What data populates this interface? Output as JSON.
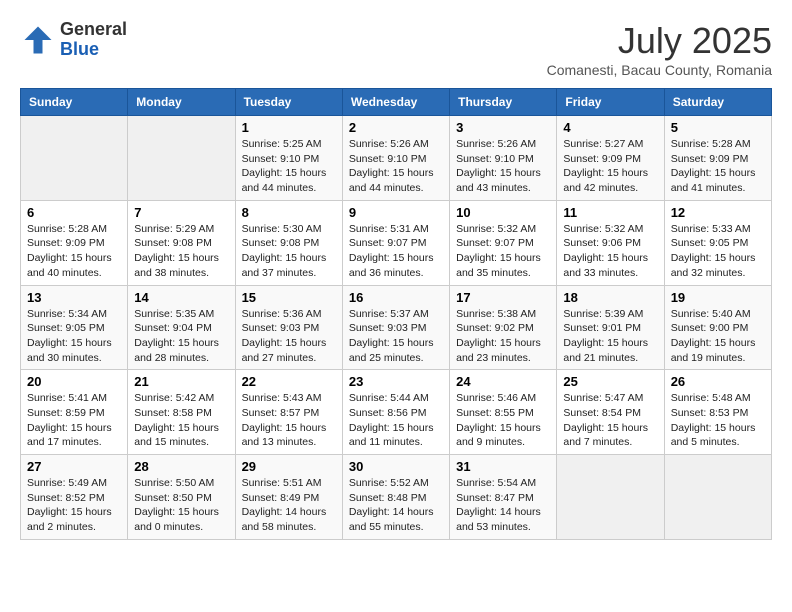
{
  "logo": {
    "general": "General",
    "blue": "Blue"
  },
  "title": {
    "month_year": "July 2025",
    "location": "Comanesti, Bacau County, Romania"
  },
  "days_of_week": [
    "Sunday",
    "Monday",
    "Tuesday",
    "Wednesday",
    "Thursday",
    "Friday",
    "Saturday"
  ],
  "weeks": [
    [
      {
        "day": "",
        "info": ""
      },
      {
        "day": "",
        "info": ""
      },
      {
        "day": "1",
        "info": "Sunrise: 5:25 AM\nSunset: 9:10 PM\nDaylight: 15 hours and 44 minutes."
      },
      {
        "day": "2",
        "info": "Sunrise: 5:26 AM\nSunset: 9:10 PM\nDaylight: 15 hours and 44 minutes."
      },
      {
        "day": "3",
        "info": "Sunrise: 5:26 AM\nSunset: 9:10 PM\nDaylight: 15 hours and 43 minutes."
      },
      {
        "day": "4",
        "info": "Sunrise: 5:27 AM\nSunset: 9:09 PM\nDaylight: 15 hours and 42 minutes."
      },
      {
        "day": "5",
        "info": "Sunrise: 5:28 AM\nSunset: 9:09 PM\nDaylight: 15 hours and 41 minutes."
      }
    ],
    [
      {
        "day": "6",
        "info": "Sunrise: 5:28 AM\nSunset: 9:09 PM\nDaylight: 15 hours and 40 minutes."
      },
      {
        "day": "7",
        "info": "Sunrise: 5:29 AM\nSunset: 9:08 PM\nDaylight: 15 hours and 38 minutes."
      },
      {
        "day": "8",
        "info": "Sunrise: 5:30 AM\nSunset: 9:08 PM\nDaylight: 15 hours and 37 minutes."
      },
      {
        "day": "9",
        "info": "Sunrise: 5:31 AM\nSunset: 9:07 PM\nDaylight: 15 hours and 36 minutes."
      },
      {
        "day": "10",
        "info": "Sunrise: 5:32 AM\nSunset: 9:07 PM\nDaylight: 15 hours and 35 minutes."
      },
      {
        "day": "11",
        "info": "Sunrise: 5:32 AM\nSunset: 9:06 PM\nDaylight: 15 hours and 33 minutes."
      },
      {
        "day": "12",
        "info": "Sunrise: 5:33 AM\nSunset: 9:05 PM\nDaylight: 15 hours and 32 minutes."
      }
    ],
    [
      {
        "day": "13",
        "info": "Sunrise: 5:34 AM\nSunset: 9:05 PM\nDaylight: 15 hours and 30 minutes."
      },
      {
        "day": "14",
        "info": "Sunrise: 5:35 AM\nSunset: 9:04 PM\nDaylight: 15 hours and 28 minutes."
      },
      {
        "day": "15",
        "info": "Sunrise: 5:36 AM\nSunset: 9:03 PM\nDaylight: 15 hours and 27 minutes."
      },
      {
        "day": "16",
        "info": "Sunrise: 5:37 AM\nSunset: 9:03 PM\nDaylight: 15 hours and 25 minutes."
      },
      {
        "day": "17",
        "info": "Sunrise: 5:38 AM\nSunset: 9:02 PM\nDaylight: 15 hours and 23 minutes."
      },
      {
        "day": "18",
        "info": "Sunrise: 5:39 AM\nSunset: 9:01 PM\nDaylight: 15 hours and 21 minutes."
      },
      {
        "day": "19",
        "info": "Sunrise: 5:40 AM\nSunset: 9:00 PM\nDaylight: 15 hours and 19 minutes."
      }
    ],
    [
      {
        "day": "20",
        "info": "Sunrise: 5:41 AM\nSunset: 8:59 PM\nDaylight: 15 hours and 17 minutes."
      },
      {
        "day": "21",
        "info": "Sunrise: 5:42 AM\nSunset: 8:58 PM\nDaylight: 15 hours and 15 minutes."
      },
      {
        "day": "22",
        "info": "Sunrise: 5:43 AM\nSunset: 8:57 PM\nDaylight: 15 hours and 13 minutes."
      },
      {
        "day": "23",
        "info": "Sunrise: 5:44 AM\nSunset: 8:56 PM\nDaylight: 15 hours and 11 minutes."
      },
      {
        "day": "24",
        "info": "Sunrise: 5:46 AM\nSunset: 8:55 PM\nDaylight: 15 hours and 9 minutes."
      },
      {
        "day": "25",
        "info": "Sunrise: 5:47 AM\nSunset: 8:54 PM\nDaylight: 15 hours and 7 minutes."
      },
      {
        "day": "26",
        "info": "Sunrise: 5:48 AM\nSunset: 8:53 PM\nDaylight: 15 hours and 5 minutes."
      }
    ],
    [
      {
        "day": "27",
        "info": "Sunrise: 5:49 AM\nSunset: 8:52 PM\nDaylight: 15 hours and 2 minutes."
      },
      {
        "day": "28",
        "info": "Sunrise: 5:50 AM\nSunset: 8:50 PM\nDaylight: 15 hours and 0 minutes."
      },
      {
        "day": "29",
        "info": "Sunrise: 5:51 AM\nSunset: 8:49 PM\nDaylight: 14 hours and 58 minutes."
      },
      {
        "day": "30",
        "info": "Sunrise: 5:52 AM\nSunset: 8:48 PM\nDaylight: 14 hours and 55 minutes."
      },
      {
        "day": "31",
        "info": "Sunrise: 5:54 AM\nSunset: 8:47 PM\nDaylight: 14 hours and 53 minutes."
      },
      {
        "day": "",
        "info": ""
      },
      {
        "day": "",
        "info": ""
      }
    ]
  ]
}
